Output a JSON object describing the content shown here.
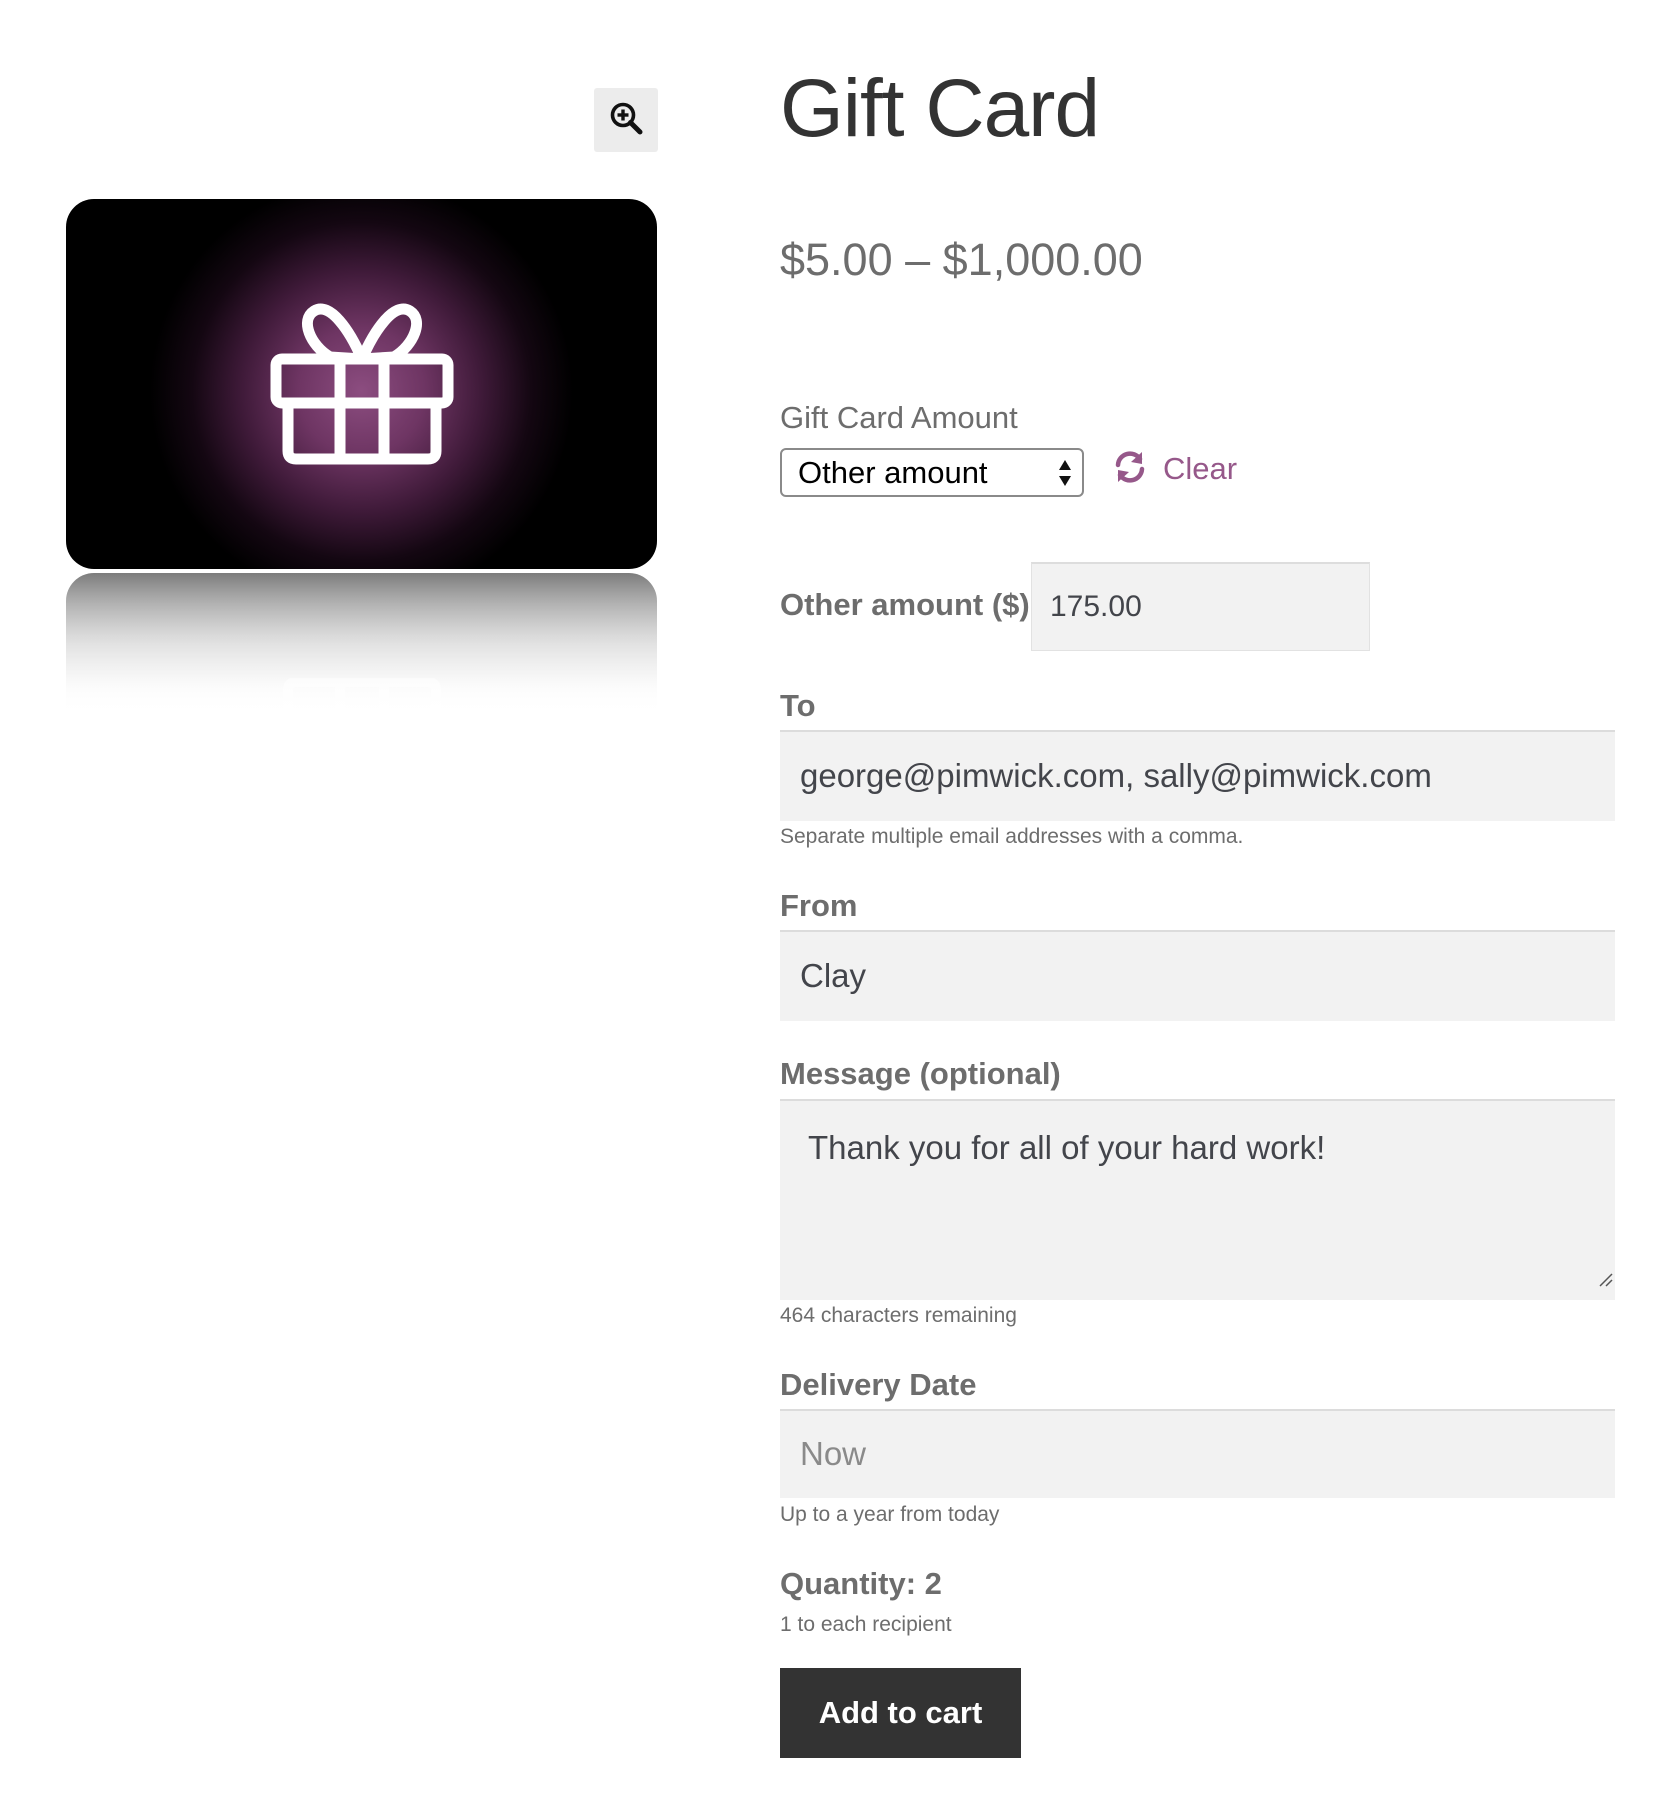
{
  "gallery": {
    "zoom_icon": "magnifier-plus-icon",
    "image_icon": "gift-icon",
    "colors": {
      "card_background": "#000000",
      "card_glow": "#8c4d80",
      "gift_outline": "#ffffff"
    }
  },
  "product": {
    "title": "Gift Card",
    "price_range": "$5.00 – $1,000.00"
  },
  "amount": {
    "label": "Gift Card Amount",
    "selected": "Other amount",
    "clear_label": "Clear",
    "clear_icon": "refresh-icon"
  },
  "other_amount": {
    "label": "Other amount ($)",
    "value": "175.00"
  },
  "to": {
    "label": "To",
    "value": "george@pimwick.com, sally@pimwick.com",
    "help": "Separate multiple email addresses with a comma."
  },
  "from": {
    "label": "From",
    "value": "Clay"
  },
  "message": {
    "label": "Message (optional)",
    "value": "Thank you for all of your hard work!",
    "remaining": "464 characters remaining"
  },
  "delivery_date": {
    "label": "Delivery Date",
    "placeholder": "Now",
    "help": "Up to a year from today"
  },
  "quantity": {
    "label": "Quantity: 2",
    "help": "1 to each recipient"
  },
  "cart": {
    "button_label": "Add to cart"
  },
  "colors": {
    "accent": "#96588a",
    "button": "#333333",
    "input_background": "#f2f2f2",
    "text": "#6d6d6d"
  }
}
